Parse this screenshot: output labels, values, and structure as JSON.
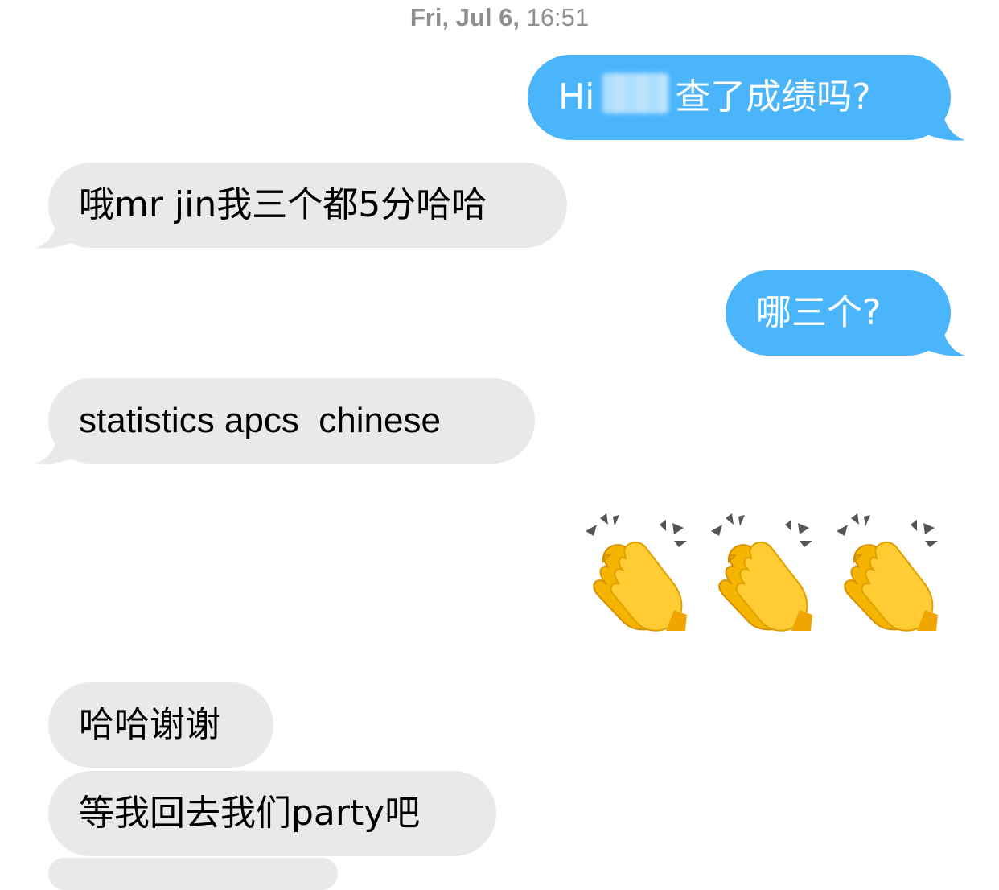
{
  "conversation": {
    "timestamp": {
      "day": "Fri, Jul 6,",
      "time": "16:51"
    },
    "messages": [
      {
        "direction": "sent",
        "text_visible": "Hi",
        "text_after_redaction": "查了成绩吗?"
      },
      {
        "direction": "received",
        "text": "哦mr jin我三个都5分哈哈"
      },
      {
        "direction": "sent",
        "text": "哪三个?"
      },
      {
        "direction": "received",
        "text": "statistics apcs  chinese"
      },
      {
        "direction": "sent",
        "emoji": [
          "clapping-hands",
          "clapping-hands",
          "clapping-hands"
        ]
      },
      {
        "direction": "received",
        "text": "哈哈谢谢"
      },
      {
        "direction": "received",
        "text": "等我回去我们party吧"
      }
    ]
  },
  "colors": {
    "sent_bubble": "#4ab5fb",
    "received_bubble": "#e9e9eb",
    "timestamp": "#8e8e93",
    "background": "#ffffff"
  }
}
